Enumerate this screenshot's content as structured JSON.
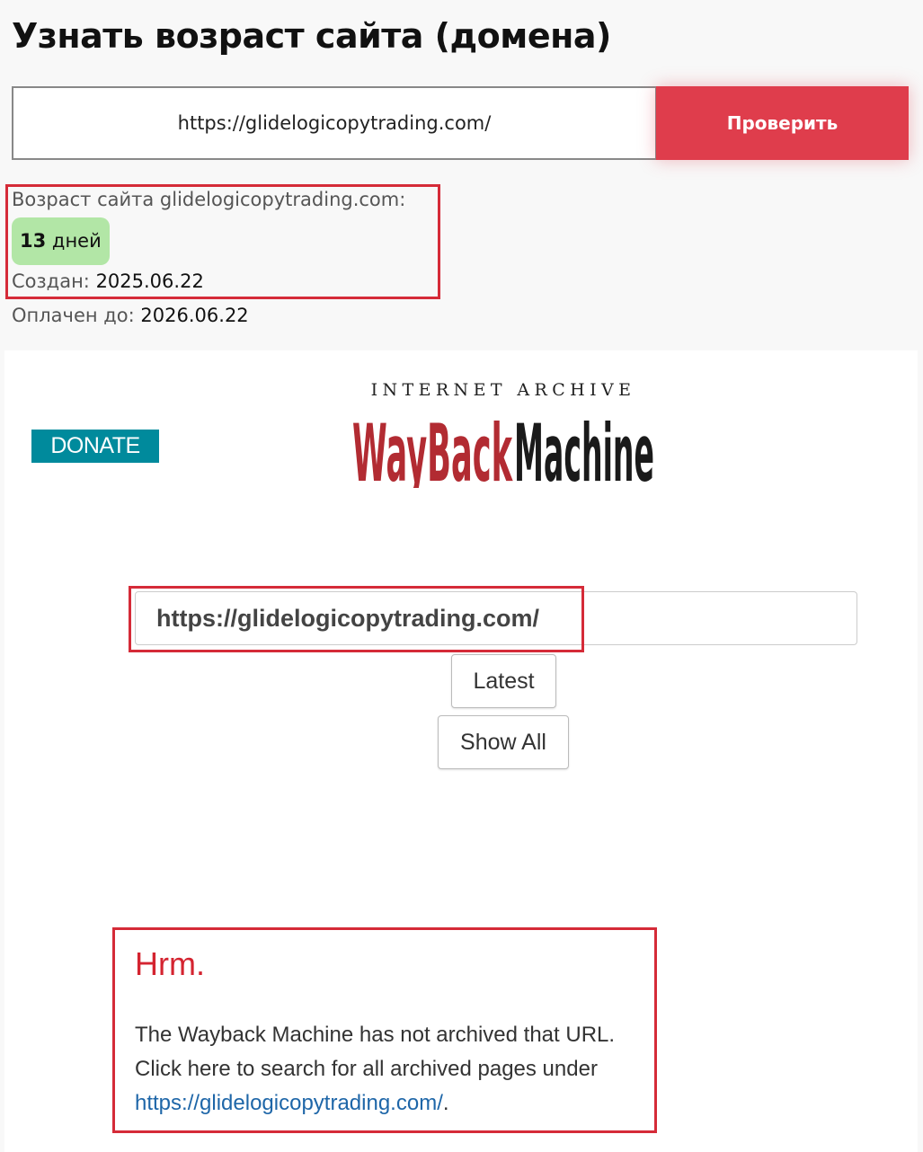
{
  "header": {
    "title": "Узнать возраст сайта (домена)"
  },
  "check_form": {
    "url_value": "https://glidelogicopytrading.com/",
    "submit_label": "Проверить"
  },
  "result": {
    "age_label": "Возраст сайта glidelogicopytrading.com:",
    "age_number": "13",
    "age_unit": "дней",
    "created_label": "Создан:",
    "created_value": "2025.06.22",
    "paid_label": "Оплачен до:",
    "paid_value": "2026.06.22"
  },
  "wayback": {
    "donate_label": "DONATE",
    "logo_top": "INTERNET ARCHIVE",
    "logo_wayback": "WayBack",
    "logo_machine": "Machine",
    "search_value": "https://glidelogicopytrading.com/",
    "latest_label": "Latest",
    "show_all_label": "Show All",
    "hrm_title": "Hrm.",
    "hrm_line1": "The Wayback Machine has not archived that URL.",
    "hrm_line2": "Click here to search for all archived pages under",
    "hrm_link": "https://glidelogicopytrading.com/",
    "hrm_link_suffix": "."
  },
  "colors": {
    "accent_red": "#df3d4c",
    "highlight_red": "#d52b38",
    "badge_green": "#b2e6a6",
    "donate_teal": "#008a9c",
    "wayback_red": "#b22b32",
    "link_blue": "#1e66a8"
  }
}
